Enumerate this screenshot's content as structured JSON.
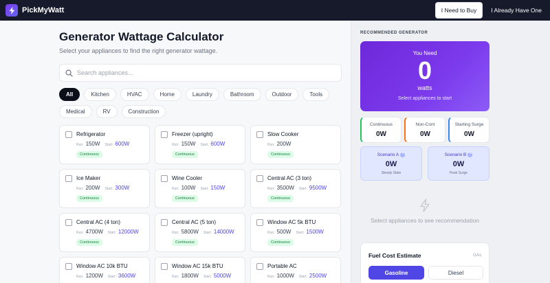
{
  "app": {
    "name": "PickMyWatt"
  },
  "header": {
    "need_to_buy_label": "I Need to Buy",
    "already_have_label": "I Already Have One"
  },
  "main": {
    "title": "Generator Wattage Calculator",
    "subtitle": "Select your appliances to find the right generator wattage.",
    "search": {
      "placeholder": "Search appliances...",
      "value": ""
    }
  },
  "categories": [
    "All",
    "Kitchen",
    "HVAC",
    "Home",
    "Laundry",
    "Bathroom",
    "Outdoor",
    "Tools",
    "Medical",
    "RV",
    "Construction"
  ],
  "selected_category": "All",
  "run_label": "Run:",
  "start_label": "Start:",
  "appliances": [
    {
      "name": "Refrigerator",
      "run": "150W",
      "start": "600W",
      "type": "Continuous"
    },
    {
      "name": "Freezer (upright)",
      "run": "150W",
      "start": "600W",
      "type": "Continuous"
    },
    {
      "name": "Slow Cooker",
      "run": "200W",
      "start": "",
      "type": "Continuous"
    },
    {
      "name": "Ice Maker",
      "run": "200W",
      "start": "300W",
      "type": "Continuous"
    },
    {
      "name": "Wine Cooler",
      "run": "100W",
      "start": "150W",
      "type": "Continuous"
    },
    {
      "name": "Central AC (3 ton)",
      "run": "3500W",
      "start": "9500W",
      "type": "Continuous"
    },
    {
      "name": "Central AC (4 ton)",
      "run": "4700W",
      "start": "12000W",
      "type": "Continuous"
    },
    {
      "name": "Central AC (5 ton)",
      "run": "5800W",
      "start": "14000W",
      "type": "Continuous"
    },
    {
      "name": "Window AC 5k BTU",
      "run": "500W",
      "start": "1500W",
      "type": "Continuous"
    },
    {
      "name": "Window AC 10k BTU",
      "run": "1200W",
      "start": "3600W",
      "type": "Continuous"
    },
    {
      "name": "Window AC 15k BTU",
      "run": "1800W",
      "start": "5000W",
      "type": "Continuous"
    },
    {
      "name": "Portable AC",
      "run": "1000W",
      "start": "2500W",
      "type": "Continuous"
    }
  ],
  "panel": {
    "heading": "RECOMMENDED GENERATOR",
    "need": {
      "label": "You Need",
      "value": "0",
      "unit": "watts",
      "hint": "Select appliances to start"
    },
    "stats": [
      {
        "label": "Continuous",
        "value": "0W",
        "color": "#22c55e"
      },
      {
        "label": "Non-Cont",
        "value": "0W",
        "color": "#f97316"
      },
      {
        "label": "Starting Surge",
        "value": "0W",
        "color": "#3b82f6"
      }
    ],
    "scenarios": [
      {
        "label": "Scenario A",
        "value": "0W",
        "sub": "Steady State"
      },
      {
        "label": "Scenario B",
        "value": "0W",
        "sub": "Peak Surge"
      }
    ],
    "help_glyph": "?",
    "empty_hint": "Select appliances to see recommendation",
    "fuel": {
      "title": "Fuel Cost Estimate",
      "unit": "GAL",
      "options": [
        "Gasoline",
        "Diesel"
      ],
      "selected": "Gasoline"
    }
  },
  "colors": {
    "accent": "#4f46e5",
    "header_bg": "#161a2b",
    "hero_gradient_start": "#6d28d9",
    "hero_gradient_end": "#8b5cf6"
  }
}
